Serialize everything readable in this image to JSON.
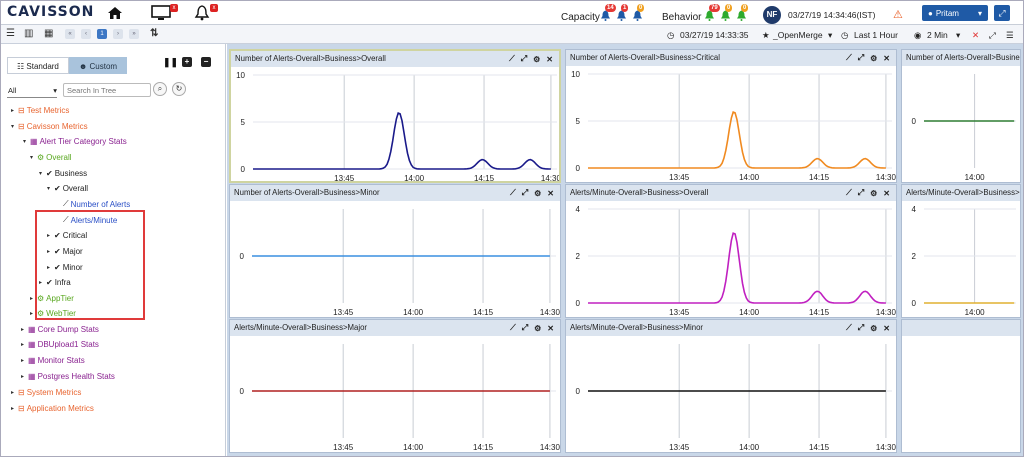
{
  "header": {
    "logo": "CAVISSON",
    "capacity_label": "Capacity",
    "behavior_label": "Behavior",
    "capacity_badges": [
      "14",
      "1",
      "0"
    ],
    "behavior_badges": [
      "79",
      "0",
      "0"
    ],
    "user_initials": "NF",
    "datetime": "03/27/19 14:34:46(IST)",
    "user_name": "Pritam",
    "colors": {
      "capacity_badges": [
        "#e53935",
        "#e53935",
        "#f0a020"
      ],
      "behavior_badges": [
        "#e53935",
        "#f0a020",
        "#f0a020"
      ],
      "behavior_icons": [
        "#2eaa2e",
        "#2eaa2e",
        "#2eaa2e"
      ]
    }
  },
  "toolbar": {
    "page": "1",
    "time": "03/27/19 14:33:35",
    "merge": "_OpenMerge",
    "range": "Last 1 Hour",
    "interval": "2 Min"
  },
  "sidebar": {
    "tab_standard": "Standard",
    "tab_custom": "Custom",
    "filter": "All",
    "search_placeholder": "Search In Tree",
    "tree": [
      {
        "label": "Test Metrics",
        "color": "orange",
        "icon": "db-icon"
      },
      {
        "label": "Cavisson Metrics",
        "color": "orange",
        "icon": "db-icon"
      },
      {
        "label": "Alert Tier Category Stats",
        "color": "purple",
        "icon": "grid-icon"
      },
      {
        "label": "Overall",
        "color": "green",
        "icon": "gears-icon"
      },
      {
        "label": "Business",
        "color": "dark",
        "icon": "check-icon"
      },
      {
        "label": "Overall",
        "color": "dark",
        "icon": "check-icon"
      },
      {
        "label": "Number of Alerts",
        "color": "blue",
        "icon": "graph-icon"
      },
      {
        "label": "Alerts/Minute",
        "color": "blue",
        "icon": "graph-icon"
      },
      {
        "label": "Critical",
        "color": "dark",
        "icon": "check-icon"
      },
      {
        "label": "Major",
        "color": "dark",
        "icon": "check-icon"
      },
      {
        "label": "Minor",
        "color": "dark",
        "icon": "check-icon"
      },
      {
        "label": "Infra",
        "color": "dark",
        "icon": "check-icon"
      },
      {
        "label": "AppTier",
        "color": "green",
        "icon": "gears-icon"
      },
      {
        "label": "WebTier",
        "color": "green",
        "icon": "gears-icon"
      },
      {
        "label": "Core Dump Stats",
        "color": "purple",
        "icon": "grid-icon"
      },
      {
        "label": "DBUpload1 Stats",
        "color": "purple",
        "icon": "grid-icon"
      },
      {
        "label": "Monitor Stats",
        "color": "purple",
        "icon": "grid-icon"
      },
      {
        "label": "Postgres Health Stats",
        "color": "purple",
        "icon": "grid-icon"
      },
      {
        "label": "System Metrics",
        "color": "orange",
        "icon": "db-icon"
      },
      {
        "label": "Application Metrics",
        "color": "orange",
        "icon": "db-icon"
      }
    ]
  },
  "chart_data": [
    {
      "type": "line",
      "title": "Number of Alerts-Overall>Business>Overall",
      "x": [
        "13:45",
        "14:00",
        "14:15",
        "14:30"
      ],
      "yticks": [
        0,
        5,
        10
      ],
      "ylim": [
        0,
        10
      ],
      "series": [
        {
          "color": "#1a1a8a",
          "peaks": [
            [
              0.49,
              6
            ],
            [
              0.77,
              1
            ],
            [
              0.93,
              1
            ]
          ]
        }
      ]
    },
    {
      "type": "line",
      "title": "Number of Alerts-Overall>Business>Critical",
      "x": [
        "13:45",
        "14:00",
        "14:15",
        "14:30"
      ],
      "yticks": [
        0,
        5,
        10
      ],
      "ylim": [
        0,
        10
      ],
      "series": [
        {
          "color": "#f08a20",
          "peaks": [
            [
              0.49,
              6
            ],
            [
              0.77,
              1
            ],
            [
              0.93,
              1
            ]
          ]
        }
      ]
    },
    {
      "type": "line",
      "title": "Number of Alerts-Overall>Business>Major",
      "x": [
        "14:00"
      ],
      "yticks": [
        0
      ],
      "ylim": [
        -1,
        1
      ],
      "series": [
        {
          "color": "#2e7d32",
          "peaks": []
        }
      ]
    },
    {
      "type": "line",
      "title": "Number of Alerts-Overall>Business>Minor",
      "x": [
        "13:45",
        "14:00",
        "14:15",
        "14:30"
      ],
      "yticks": [
        0
      ],
      "ylim": [
        -1,
        1
      ],
      "series": [
        {
          "color": "#3a8fe0",
          "peaks": []
        }
      ]
    },
    {
      "type": "line",
      "title": "Alerts/Minute-Overall>Business>Overall",
      "x": [
        "13:45",
        "14:00",
        "14:15",
        "14:30"
      ],
      "yticks": [
        0,
        2,
        4
      ],
      "ylim": [
        0,
        4
      ],
      "series": [
        {
          "color": "#c020c0",
          "peaks": [
            [
              0.49,
              3
            ],
            [
              0.77,
              0.5
            ],
            [
              0.93,
              0.5
            ]
          ]
        }
      ]
    },
    {
      "type": "line",
      "title": "Alerts/Minute-Overall>Business>Critical",
      "x": [
        "14:00"
      ],
      "yticks": [
        0,
        2,
        4
      ],
      "ylim": [
        0,
        4
      ],
      "series": [
        {
          "color": "#e0b030",
          "peaks": []
        }
      ]
    },
    {
      "type": "line",
      "title": "Alerts/Minute-Overall>Business>Major",
      "x": [
        "13:45",
        "14:00",
        "14:15",
        "14:30"
      ],
      "yticks": [
        0
      ],
      "ylim": [
        -1,
        1
      ],
      "series": [
        {
          "color": "#b02020",
          "peaks": []
        }
      ]
    },
    {
      "type": "line",
      "title": "Alerts/Minute-Overall>Business>Minor",
      "x": [
        "13:45",
        "14:00",
        "14:15",
        "14:30"
      ],
      "yticks": [
        0
      ],
      "ylim": [
        -1,
        1
      ],
      "series": [
        {
          "color": "#111111",
          "peaks": []
        }
      ]
    }
  ]
}
